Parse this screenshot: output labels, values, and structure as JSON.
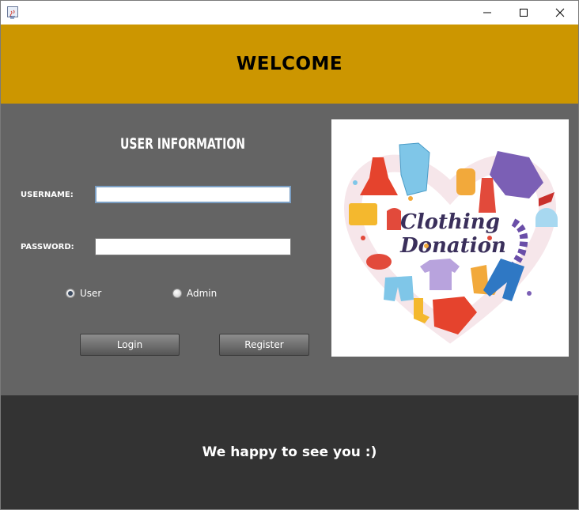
{
  "window": {
    "icons": {
      "app": "java-app-icon",
      "minimize": "minimize-icon",
      "maximize": "maximize-icon",
      "close": "close-icon"
    }
  },
  "header": {
    "title": "WELCOME"
  },
  "form": {
    "section_title": "USER INFORMATION",
    "username_label": "USERNAME:",
    "username_value": "",
    "password_label": "PASSWORD:",
    "password_value": "",
    "roles": [
      {
        "label": "User",
        "selected": true
      },
      {
        "label": "Admin",
        "selected": false
      }
    ],
    "login_label": "Login",
    "register_label": "Register"
  },
  "poster": {
    "line1": "Clothing",
    "line2": "Donation"
  },
  "footer": {
    "message": "We happy to see you :)"
  },
  "colors": {
    "header_band": "#cc9600",
    "main_bg": "#646464",
    "footer_bg": "#333333",
    "heart_accent": "#e24a3b"
  }
}
